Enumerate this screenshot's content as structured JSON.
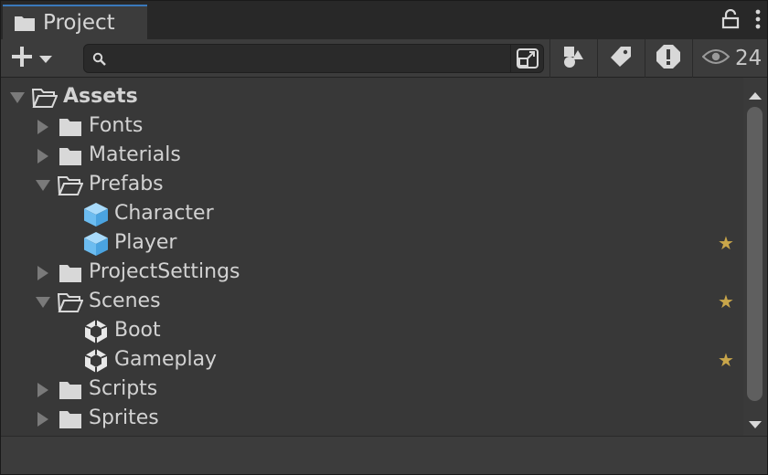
{
  "tab": {
    "title": "Project",
    "icon": "folder-icon"
  },
  "header_icons": [
    "lock-icon",
    "more-icon"
  ],
  "toolbar": {
    "add_icon": "plus-icon",
    "add_dropdown_icon": "chevron-down-icon",
    "search": {
      "value": "",
      "placeholder": "",
      "icon": "search-icon",
      "expand_icon": "open-in-window-icon"
    },
    "filters": [
      {
        "name": "filter-by-type-button",
        "icon": "shapes-icon"
      },
      {
        "name": "filter-by-label-button",
        "icon": "tag-icon"
      },
      {
        "name": "filter-by-log-type-button",
        "icon": "warning-icon"
      }
    ],
    "visibility": {
      "icon": "eye-icon",
      "count": "24"
    }
  },
  "tree": [
    {
      "label": "Assets",
      "depth": 0,
      "expanded": true,
      "type": "folder-open",
      "bold": true,
      "favorite": false
    },
    {
      "label": "Fonts",
      "depth": 1,
      "expanded": false,
      "type": "folder",
      "favorite": false
    },
    {
      "label": "Materials",
      "depth": 1,
      "expanded": false,
      "type": "folder",
      "favorite": false
    },
    {
      "label": "Prefabs",
      "depth": 1,
      "expanded": true,
      "type": "folder-open",
      "favorite": false
    },
    {
      "label": "Character",
      "depth": 2,
      "type": "prefab",
      "favorite": false
    },
    {
      "label": "Player",
      "depth": 2,
      "type": "prefab",
      "favorite": true
    },
    {
      "label": "ProjectSettings",
      "depth": 1,
      "expanded": false,
      "type": "folder",
      "favorite": false
    },
    {
      "label": "Scenes",
      "depth": 1,
      "expanded": true,
      "type": "folder-open",
      "favorite": true
    },
    {
      "label": "Boot",
      "depth": 2,
      "type": "scene",
      "favorite": false
    },
    {
      "label": "Gameplay",
      "depth": 2,
      "type": "scene",
      "favorite": true
    },
    {
      "label": "Scripts",
      "depth": 1,
      "expanded": false,
      "type": "folder",
      "favorite": false
    },
    {
      "label": "Sprites",
      "depth": 1,
      "expanded": false,
      "type": "folder",
      "favorite": false
    }
  ],
  "favorite_glyph": "★",
  "colors": {
    "accent": "#3a79bb",
    "favorite": "#c9a64a",
    "prefab": "#7cc4f5",
    "background": "#383838"
  }
}
